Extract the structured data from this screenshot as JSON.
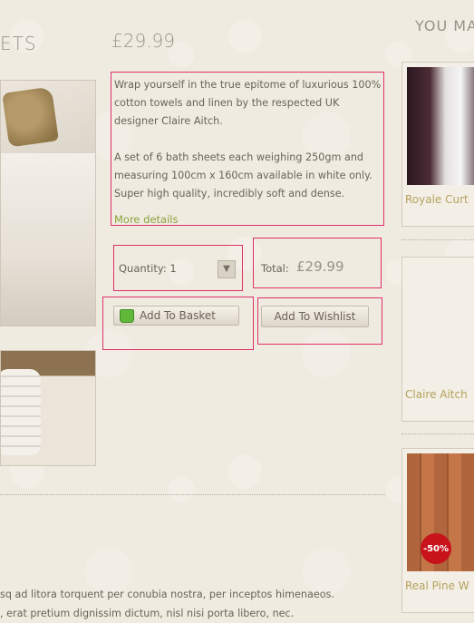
{
  "header": {
    "title_fragment": "ETS",
    "price": "£29.99"
  },
  "product": {
    "description_1": "Wrap yourself in the true epitome of luxurious 100% cotton towels and linen by the respected UK designer Claire Aitch.",
    "description_2": "A set of 6 bath sheets each weighing 250gm and measuring 100cm x 160cm available in white only. Super high quality, incredibly soft and dense.",
    "more_details": "More details",
    "quantity_label": "Quantity: 1",
    "total_label": "Total:",
    "total_value": "£29.99",
    "add_to_basket": "Add To Basket",
    "add_to_wishlist": "Add To Wishlist"
  },
  "footer": {
    "line_1": "sq ad litora torquent per conubia nostra, per inceptos himenaeos.",
    "line_2": ", erat pretium dignissim dictum, nisl nisi porta libero, nec."
  },
  "sidebar": {
    "title": "YOU MA",
    "items": [
      {
        "label": "Royale Curt",
        "image": "curtain-image"
      },
      {
        "label": "Claire Aitch",
        "image": "sofa-image"
      },
      {
        "label": "Real Pine W",
        "image": "floor-image",
        "badge": "-50%"
      }
    ]
  },
  "colors": {
    "highlight_border": "#e0306a",
    "link_green": "#8aa33b",
    "sidebar_label": "#b5a15b",
    "sale_badge": "#c8131b"
  }
}
